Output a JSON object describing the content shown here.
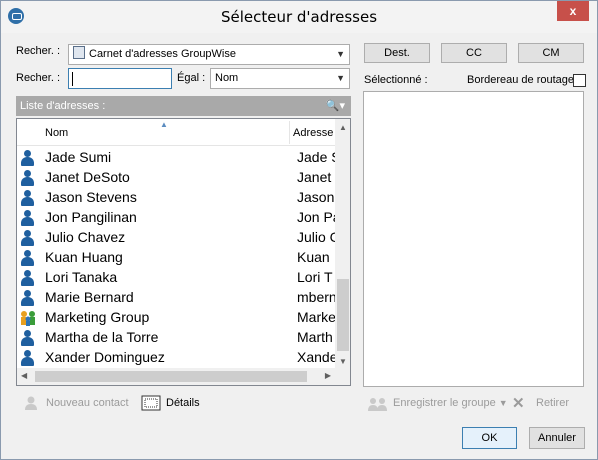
{
  "window": {
    "title": "Sélecteur d'adresses",
    "close_glyph": "x",
    "app_icon": "groupwise-icon"
  },
  "search": {
    "label1": "Recher. :",
    "addressbook_value": "Carnet d'adresses GroupWise",
    "label2": "Recher. :",
    "query_value": "",
    "equal_label": "Égal :",
    "field_value": "Nom"
  },
  "recipient_buttons": {
    "dest": "Dest.",
    "cc": "CC",
    "cm": "CM"
  },
  "selected": {
    "label": "Sélectionné :",
    "routing_label": "Bordereau de routage",
    "routing_checked": false
  },
  "address_list": {
    "header": "Liste d'adresses :",
    "columns": [
      "Nom",
      "Adresse"
    ],
    "rows": [
      {
        "name": "Jade Sumi",
        "addr": "Jade S",
        "type": "person"
      },
      {
        "name": "Janet DeSoto",
        "addr": "Janet",
        "type": "person"
      },
      {
        "name": "Jason Stevens",
        "addr": "Jason",
        "type": "person"
      },
      {
        "name": "Jon Pangilinan",
        "addr": "Jon Pa",
        "type": "person"
      },
      {
        "name": "Julio Chavez",
        "addr": "Julio C",
        "type": "person"
      },
      {
        "name": "Kuan Huang",
        "addr": "Kuan",
        "type": "person"
      },
      {
        "name": "Lori Tanaka",
        "addr": "Lori T",
        "type": "person"
      },
      {
        "name": "Marie Bernard",
        "addr": "mbern",
        "type": "person"
      },
      {
        "name": "Marketing Group",
        "addr": "Marke",
        "type": "group"
      },
      {
        "name": "Martha de la Torre",
        "addr": "Marth",
        "type": "person"
      },
      {
        "name": "Xander Dominguez",
        "addr": "Xande",
        "type": "person"
      }
    ]
  },
  "footer": {
    "new_contact": "Nouveau contact",
    "details": "Détails",
    "save_group": "Enregistrer le groupe",
    "remove": "Retirer",
    "ok": "OK",
    "cancel": "Annuler"
  }
}
